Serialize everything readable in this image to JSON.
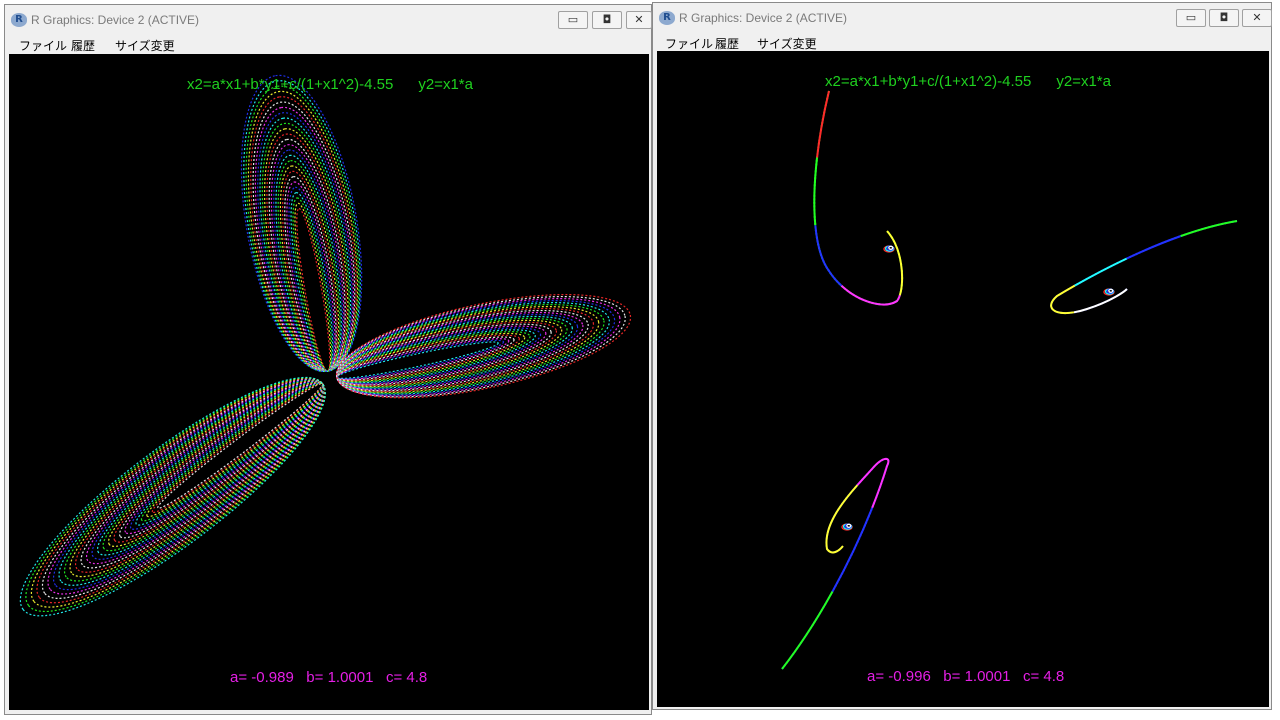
{
  "windows": [
    {
      "title": "R Graphics: Device 2 (ACTIVE)",
      "app_icon": "R",
      "menu": [
        "ファイル",
        "履歴",
        "サイズ変更"
      ],
      "controls": {
        "minimize": "▭",
        "maximize": "◘",
        "close": "✕"
      },
      "equation": "x2=a*x1+b*y1+c/(1+x1^2)-4.55      y2=x1*a",
      "params": "a= -0.989   b= 1.0001   c= 4.8"
    },
    {
      "title": "R Graphics: Device 2 (ACTIVE)",
      "app_icon": "R",
      "menu": [
        "ファイル",
        "履歴",
        "サイズ変更"
      ],
      "controls": {
        "minimize": "▭",
        "maximize": "◘",
        "close": "✕"
      },
      "equation": "x2=a*x1+b*y1+c/(1+x1^2)-4.55      y2=x1*a",
      "params": "a= -0.996   b= 1.0001   c= 4.8"
    }
  ],
  "colors": {
    "equation": "#1fd11f",
    "params": "#e51fe5",
    "palette": [
      "#ff2a2a",
      "#ffff33",
      "#22ff22",
      "#22ffff",
      "#2233ff",
      "#ff33ff",
      "#ffffff"
    ]
  }
}
